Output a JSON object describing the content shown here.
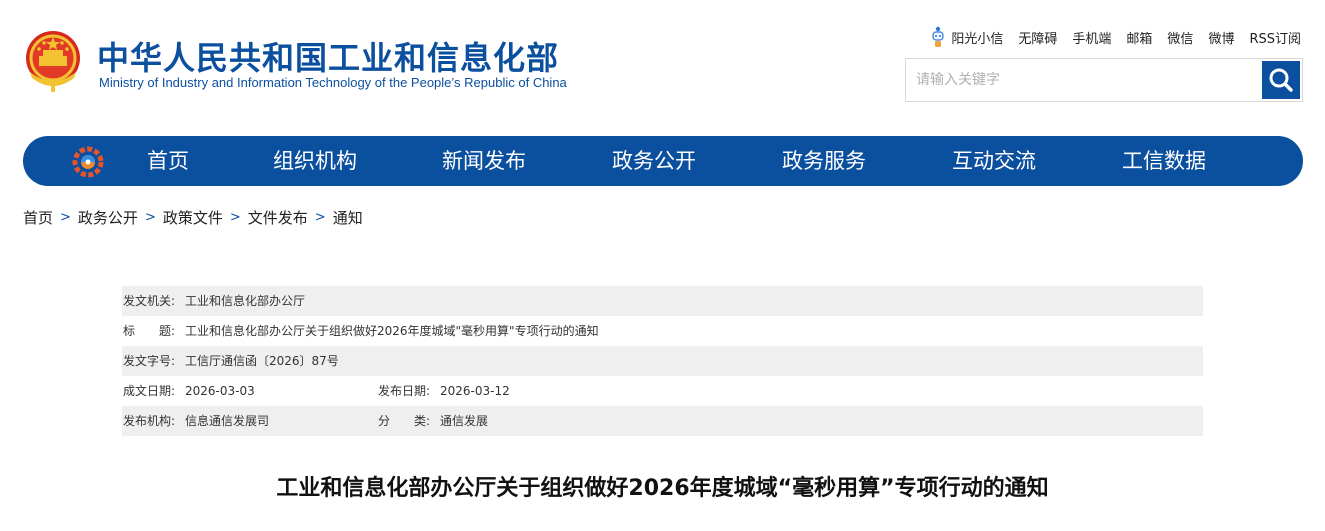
{
  "header": {
    "title": "中华人民共和国工业和信息化部",
    "subtitle": "Ministry of Industry and Information Technology of the People’s Republic of China"
  },
  "top_links": [
    "阳光小信",
    "无障碍",
    "手机端",
    "邮箱",
    "微信",
    "微博",
    "RSS订阅"
  ],
  "search": {
    "placeholder": "请输入关键字",
    "value": ""
  },
  "nav": [
    "首页",
    "组织机构",
    "新闻发布",
    "政务公开",
    "政务服务",
    "互动交流",
    "工信数据"
  ],
  "breadcrumb": [
    "首页",
    "政务公开",
    "政策文件",
    "文件发布",
    "通知"
  ],
  "breadcrumb_separator": ">",
  "meta": {
    "issuer_label": "发文机关:",
    "issuer": "工业和信息化部办公厅",
    "title_label": "标　　题:",
    "title": "工业和信息化部办公厅关于组织做好2026年度城域\"毫秒用算\"专项行动的通知",
    "doc_no_label": "发文字号:",
    "doc_no": "工信厅通信函〔2026〕87号",
    "created_label": "成文日期:",
    "created": "2026-03-03",
    "published_label": "发布日期:",
    "published": "2026-03-12",
    "org_label": "发布机构:",
    "org": "信息通信发展司",
    "category_label": "分　　类:",
    "category": "通信发展"
  },
  "document_title": "工业和信息化部办公厅关于组织做好2026年度城域“毫秒用算”专项行动的通知",
  "colors": {
    "brand_blue": "#0b4f9f",
    "meta_row_shade": "#efefef"
  },
  "icons": [
    "national-emblem",
    "robot-icon",
    "search-icon",
    "nav-logo-icon"
  ]
}
